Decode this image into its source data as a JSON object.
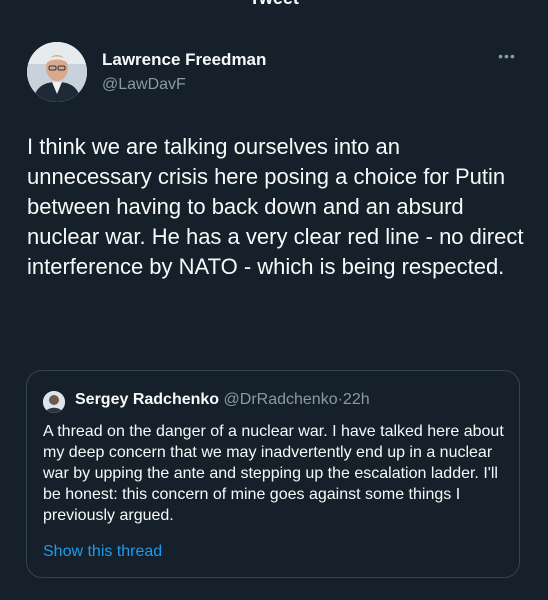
{
  "header": {
    "title": "Tweet"
  },
  "tweet": {
    "author": {
      "name": "Lawrence Freedman",
      "handle": "@LawDavF",
      "avatar_icon": "user-photo"
    },
    "more_icon": "more-horizontal-icon",
    "text": "I think we are talking ourselves into an unnecessary crisis here posing a choice for Putin between having to back down and an absurd nuclear war. He has a very clear red line - no direct interference by NATO - which is being respected."
  },
  "quote": {
    "author": {
      "name": "Sergey Radchenko",
      "handle": "@DrRadchenko",
      "separator": "·",
      "time": "22h"
    },
    "text": "A thread on the danger of a nuclear war. I have talked here about my deep concern that we may inadvertently end up in a nuclear war by upping the ante and stepping up the escalation ladder. I'll be honest: this concern of mine goes against some things I previously argued.",
    "link": "Show this thread"
  },
  "colors": {
    "background": "#15202b",
    "text": "#f7f9f9",
    "secondary": "#8b98a5",
    "link": "#1d9bf0",
    "border": "#38444d"
  }
}
